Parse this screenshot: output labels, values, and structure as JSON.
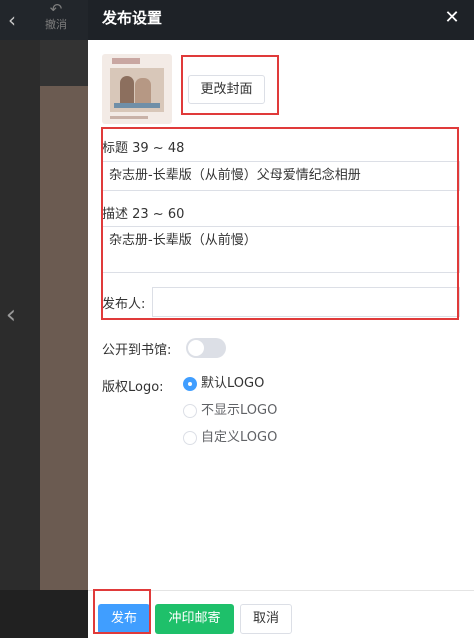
{
  "editor": {
    "back_icon": "chevron-left-icon",
    "undo_icon": "undo-arrow-icon",
    "undo_label": "撤消",
    "prev_page_icon": "chevron-left-icon"
  },
  "dialog": {
    "title": "发布设置",
    "close_icon": "close-icon",
    "change_cover_label": "更改封面",
    "title_field": {
      "label": "标题 39 ~ 48",
      "value": "杂志册-长辈版（从前慢）父母爱情纪念相册"
    },
    "description_field": {
      "label": "描述 23 ~ 60",
      "value": "杂志册-长辈版（从前慢）"
    },
    "publisher_field": {
      "label": "发布人:",
      "value": ""
    },
    "library_toggle": {
      "label": "公开到书馆:",
      "on": false
    },
    "copyright_logo": {
      "label": "版权Logo:",
      "options": [
        "默认LOGO",
        "不显示LOGO",
        "自定义LOGO"
      ],
      "selected": "默认LOGO"
    },
    "buttons": {
      "publish": "发布",
      "print_mail": "冲印邮寄",
      "cancel": "取消"
    }
  },
  "colors": {
    "header_bg": "#1e2227",
    "primary": "#409eff",
    "success": "#1ec06a",
    "highlight": "#e03a3a"
  }
}
